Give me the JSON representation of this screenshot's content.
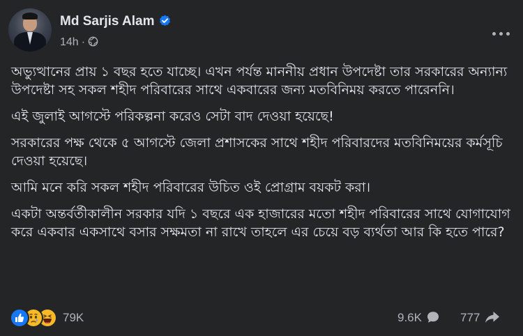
{
  "post": {
    "author": "Md Sarjis Alam",
    "verified": true,
    "time": "14h",
    "separator": "·",
    "privacy_icon": "globe-icon",
    "more_icon": "ellipsis-icon",
    "paragraphs": [
      "অভ্যুত্থানের প্রায় ১ বছর হতে যাচ্ছে। এখন পর্যন্ত মাননীয় প্রধান উপদেষ্টা তার সরকারের অন্যান্য উপদেষ্টা সহ সকল শহীদ পরিবারের সাথে একবারের জন্য মতবিনিময় করতে পারেননি।",
      "এই জুলাই আগস্টে পরিকল্পনা করেও সেটা বাদ দেওয়া হয়েছে!",
      "সরকারের পক্ষ থেকে ৫ আগস্টে জেলা প্রশাসকের সাথে শহীদ পরিবারদের মতবিনিময়ের কর্মসূচি দেওয়া হয়েছে।",
      "আমি মনে করি সকল শহীদ পরিবারের উচিত ওই প্রোগ্রাম বয়কট করা।",
      "একটা অন্তর্বর্তীকালীন সরকার যদি ১ বছরে এক হাজারের মতো শহীদ পরিবারের সাথে যোগাযোগ করে একবার একসাথে বসার সক্ষমতা না রাখে তাহলে এর চেয়ে বড় ব্যর্থতা আর কি হতে পারে?"
    ]
  },
  "footer": {
    "reaction_icons": [
      "like-icon",
      "sad-icon",
      "haha-icon"
    ],
    "reaction_count": "79K",
    "comment_count": "9.6K",
    "comment_icon": "comment-icon",
    "share_count": "777",
    "share_icon": "share-icon"
  },
  "colors": {
    "background": "#242526",
    "text_primary": "#e4e6eb",
    "text_secondary": "#b0b3b8",
    "verified_badge": "#1877f2",
    "like": "#1877f2",
    "emoji_yellow": "#f7b928"
  }
}
